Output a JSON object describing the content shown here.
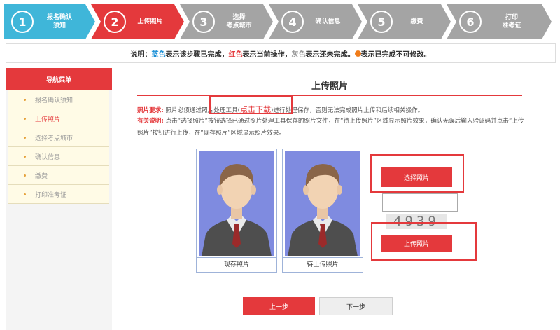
{
  "steps": [
    {
      "num": "1",
      "label": "报名确认\n须知",
      "state": "done"
    },
    {
      "num": "2",
      "label": "上传照片",
      "state": "current"
    },
    {
      "num": "3",
      "label": "选择\n考点城市",
      "state": "todo"
    },
    {
      "num": "4",
      "label": "确认信息",
      "state": "todo"
    },
    {
      "num": "5",
      "label": "缴费",
      "state": "todo"
    },
    {
      "num": "6",
      "label": "打印\n准考证",
      "state": "todo"
    }
  ],
  "notice": {
    "prefix": "说明：",
    "blue": "蓝色",
    "blue_text": "表示该步骤已完成，",
    "red": "红色",
    "red_text": "表示当前操作，",
    "gray": "灰色",
    "gray_text": "表示还未完成。",
    "dot_text": "表示已完成不可修改。"
  },
  "sidebar": {
    "title": "导航菜单",
    "items": [
      {
        "label": "报名确认须知"
      },
      {
        "label": "上传照片"
      },
      {
        "label": "选择考点城市"
      },
      {
        "label": "确认信息"
      },
      {
        "label": "缴费"
      },
      {
        "label": "打印准考证"
      }
    ]
  },
  "main": {
    "title": "上传照片",
    "req_label": "照片要求:",
    "req_text1": "照片必须通过照片处理工具(",
    "req_download": "点击下载",
    "req_text2": ")进行处理保存，否则无法完成照片上传和后续相关操作。",
    "note_label": "有关说明:",
    "note_text": "点击“选择照片”按钮选择已通过照片处理工具保存的照片文件，在“待上传照片”区域显示照片效果，确认无误后输入验证码并点击“上传照片”按钮进行上传，在“现存照片”区域显示照片效果。",
    "photo_current": "现存照片",
    "photo_pending": "待上传照片",
    "select_btn": "选择照片",
    "captcha_input": "",
    "captcha_text": "4939",
    "upload_btn": "上传照片",
    "prev_btn": "上一步",
    "next_btn": "下一步"
  },
  "colors": {
    "done": "#3fb6d9",
    "current": "#e4393c",
    "todo": "#a4a4a4",
    "bg_photo": "#7f8be0"
  }
}
